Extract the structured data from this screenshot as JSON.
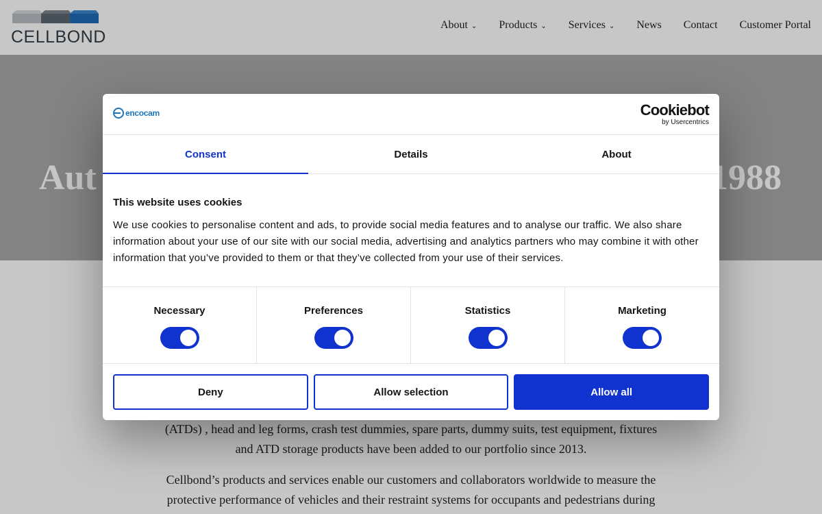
{
  "site": {
    "logo_text": "CELLBOND",
    "nav": [
      {
        "label": "About",
        "dropdown": true
      },
      {
        "label": "Products",
        "dropdown": true
      },
      {
        "label": "Services",
        "dropdown": true
      },
      {
        "label": "News",
        "dropdown": false
      },
      {
        "label": "Contact",
        "dropdown": false
      },
      {
        "label": "Customer Portal",
        "dropdown": false
      }
    ],
    "chevron": "⌄"
  },
  "hero": {
    "title_left": "Aut",
    "title_right": "1988"
  },
  "body": {
    "paragraph1_line1": "(ATDs) , head and leg forms, crash test dummies, spare parts, dummy suits, test equipment, fixtures",
    "paragraph1_line2": "and ATD storage products have been added to our portfolio since 2013.",
    "paragraph2_line1": "Cellbond’s products and services enable our customers and collaborators worldwide to measure the",
    "paragraph2_line2": "protective performance of vehicles and their restraint systems for occupants and pedestrians during"
  },
  "consent_dialog": {
    "brand": "encocam",
    "provider_main": "Cookiebot",
    "provider_sub": "by Usercentrics",
    "tabs": [
      {
        "label": "Consent",
        "active": true
      },
      {
        "label": "Details",
        "active": false
      },
      {
        "label": "About",
        "active": false
      }
    ],
    "heading": "This website uses cookies",
    "text": "We use cookies to personalise content and ads, to provide social media features and to analyse our traffic. We also share information about your use of our site with our social media, advertising and analytics partners who may combine it with other information that you’ve provided to them or that they’ve collected from your use of their services.",
    "toggles": [
      {
        "label": "Necessary",
        "on": true
      },
      {
        "label": "Preferences",
        "on": true
      },
      {
        "label": "Statistics",
        "on": true
      },
      {
        "label": "Marketing",
        "on": true
      }
    ],
    "buttons": {
      "deny": "Deny",
      "allow_selection": "Allow selection",
      "allow_all": "Allow all"
    }
  },
  "colors": {
    "accent": "#1032cf",
    "hero_bg": "#a8a8a8",
    "logo_light": "#b9bec4",
    "logo_dark": "#5b6670",
    "logo_blue": "#1f6bb5"
  }
}
